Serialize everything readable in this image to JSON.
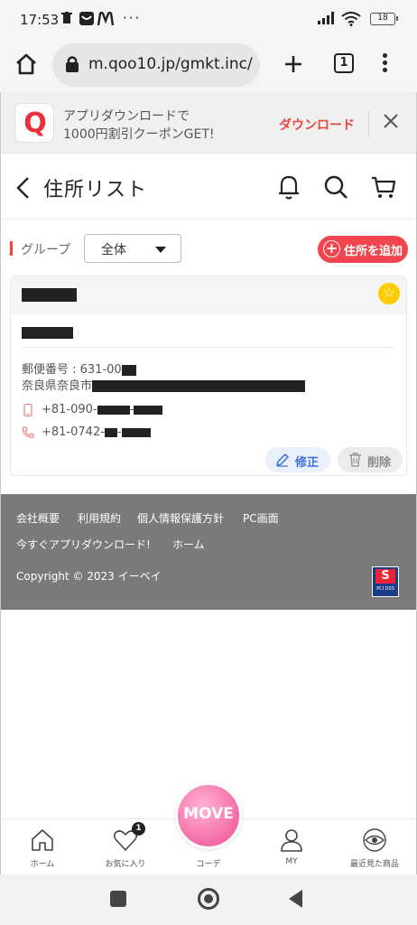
{
  "status_bar": {
    "time": "17:53",
    "battery": "18"
  },
  "browser": {
    "url": "m.qoo10.jp/gmkt.inc/",
    "tab_count": "1"
  },
  "app_banner": {
    "line1": "アプリダウンロードで",
    "line2": "1000円割引クーポンGET!",
    "download_label": "ダウンロード",
    "logo_letter": "Q"
  },
  "header": {
    "title": "住所リスト"
  },
  "group": {
    "label": "グループ",
    "selected": "全体",
    "add_label": "住所を追加"
  },
  "address_card": {
    "zip_prefix": "郵便番号 : 631-00",
    "prefecture_prefix": "奈良県奈良市",
    "mobile_prefix": "+81-090-",
    "phone_prefix": "+81-0742-",
    "edit_label": "修正",
    "delete_label": "削除"
  },
  "footer": {
    "links_row1": [
      "会社概要",
      "利用規約",
      "個人情報保護方針",
      "PC画面"
    ],
    "links_row2": [
      "今すぐアプリダウンロード!",
      "ホーム"
    ],
    "copyright": "Copyright © 2023 イーベイ"
  },
  "bottom_nav": {
    "items": [
      {
        "label": "ホーム",
        "icon": "home-icon"
      },
      {
        "label": "お気に入り",
        "icon": "heart-icon",
        "badge": "1"
      },
      {
        "label": "コーデ",
        "icon": "move-icon"
      },
      {
        "label": "MY",
        "icon": "person-icon"
      },
      {
        "label": "最近見た商品",
        "icon": "eye-icon"
      }
    ],
    "move_label": "MOVE"
  },
  "colors": {
    "accent": "#f0444e",
    "edit_blue": "#3b6fd6",
    "footer_bg": "#7a7a7a",
    "star": "#ffcc00"
  }
}
